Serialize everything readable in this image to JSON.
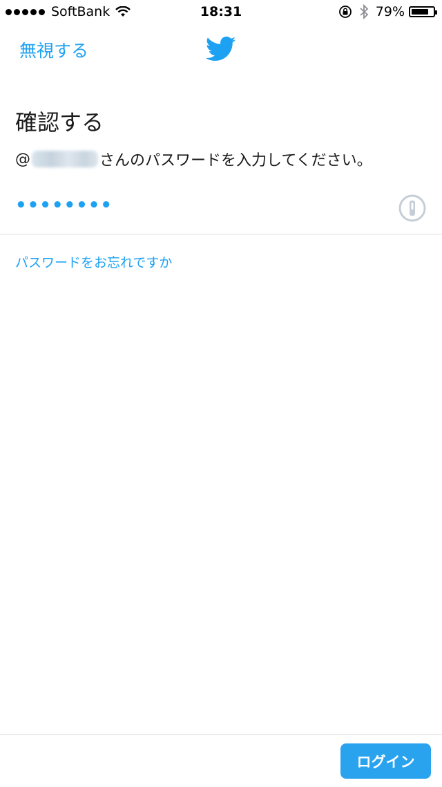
{
  "status_bar": {
    "carrier": "SoftBank",
    "time": "18:31",
    "battery": "79%",
    "battery_level": 0.79,
    "signal_bars": 5,
    "icons": [
      "wifi-icon",
      "rotation-lock-icon",
      "bluetooth-icon",
      "battery-icon"
    ]
  },
  "nav": {
    "ignore_label": "無視する",
    "logo_icon": "twitter-bird-icon"
  },
  "page": {
    "title": "確認する",
    "instruction_prefix": "@",
    "instruction_suffix": "さんのパスワードを入力してください。"
  },
  "password": {
    "value": "••••••••",
    "manager_icon": "1password-icon"
  },
  "forgot_link": "パスワードをお忘れですか",
  "login_button": "ログイン",
  "colors": {
    "accent": "#1da1f2",
    "button": "#2aa3ef",
    "divider": "#dcdcdc",
    "icon_gray": "#c5ced6"
  }
}
